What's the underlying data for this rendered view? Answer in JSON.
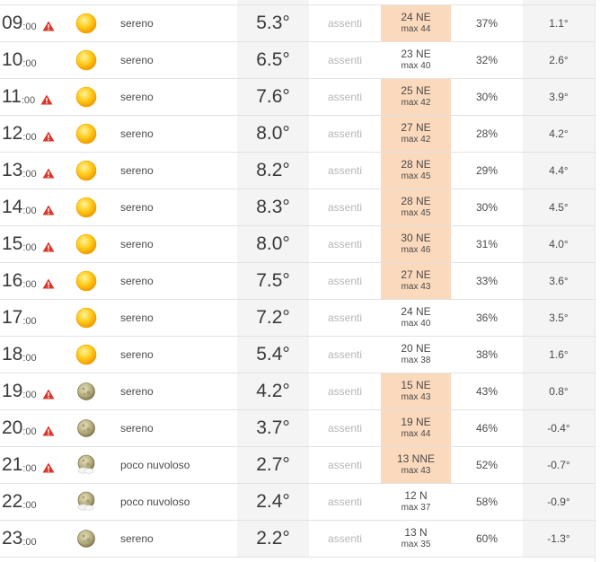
{
  "colors": {
    "warning": "#d9382b",
    "gust_highlight": "#fbd9bd",
    "sun": "#f7b500",
    "moon": "#a39b6a"
  },
  "rows": [
    {
      "hour": "09",
      "min": ":00",
      "warning": true,
      "icon": "sun-icon",
      "desc": "sereno",
      "temp": "5.3°",
      "precip": "assenti",
      "wind": "24 NE",
      "gust": "max 44",
      "highlight": true,
      "humidity": "37%",
      "dew": "1.1°"
    },
    {
      "hour": "10",
      "min": ":00",
      "warning": false,
      "icon": "sun-icon",
      "desc": "sereno",
      "temp": "6.5°",
      "precip": "assenti",
      "wind": "23 NE",
      "gust": "max 40",
      "highlight": false,
      "humidity": "32%",
      "dew": "2.6°"
    },
    {
      "hour": "11",
      "min": ":00",
      "warning": true,
      "icon": "sun-icon",
      "desc": "sereno",
      "temp": "7.6°",
      "precip": "assenti",
      "wind": "25 NE",
      "gust": "max 42",
      "highlight": true,
      "humidity": "30%",
      "dew": "3.9°"
    },
    {
      "hour": "12",
      "min": ":00",
      "warning": true,
      "icon": "sun-icon",
      "desc": "sereno",
      "temp": "8.0°",
      "precip": "assenti",
      "wind": "27 NE",
      "gust": "max 42",
      "highlight": true,
      "humidity": "28%",
      "dew": "4.2°"
    },
    {
      "hour": "13",
      "min": ":00",
      "warning": true,
      "icon": "sun-icon",
      "desc": "sereno",
      "temp": "8.2°",
      "precip": "assenti",
      "wind": "28 NE",
      "gust": "max 45",
      "highlight": true,
      "humidity": "29%",
      "dew": "4.4°"
    },
    {
      "hour": "14",
      "min": ":00",
      "warning": true,
      "icon": "sun-icon",
      "desc": "sereno",
      "temp": "8.3°",
      "precip": "assenti",
      "wind": "28 NE",
      "gust": "max 45",
      "highlight": true,
      "humidity": "30%",
      "dew": "4.5°"
    },
    {
      "hour": "15",
      "min": ":00",
      "warning": true,
      "icon": "sun-icon",
      "desc": "sereno",
      "temp": "8.0°",
      "precip": "assenti",
      "wind": "30 NE",
      "gust": "max 46",
      "highlight": true,
      "humidity": "31%",
      "dew": "4.0°"
    },
    {
      "hour": "16",
      "min": ":00",
      "warning": true,
      "icon": "sun-icon",
      "desc": "sereno",
      "temp": "7.5°",
      "precip": "assenti",
      "wind": "27 NE",
      "gust": "max 43",
      "highlight": true,
      "humidity": "33%",
      "dew": "3.6°"
    },
    {
      "hour": "17",
      "min": ":00",
      "warning": false,
      "icon": "sun-icon",
      "desc": "sereno",
      "temp": "7.2°",
      "precip": "assenti",
      "wind": "24 NE",
      "gust": "max 40",
      "highlight": false,
      "humidity": "36%",
      "dew": "3.5°"
    },
    {
      "hour": "18",
      "min": ":00",
      "warning": false,
      "icon": "sun-icon",
      "desc": "sereno",
      "temp": "5.4°",
      "precip": "assenti",
      "wind": "20 NE",
      "gust": "max 38",
      "highlight": false,
      "humidity": "38%",
      "dew": "1.6°"
    },
    {
      "hour": "19",
      "min": ":00",
      "warning": true,
      "icon": "moon-icon",
      "desc": "sereno",
      "temp": "4.2°",
      "precip": "assenti",
      "wind": "15 NE",
      "gust": "max 43",
      "highlight": true,
      "humidity": "43%",
      "dew": "0.8°"
    },
    {
      "hour": "20",
      "min": ":00",
      "warning": true,
      "icon": "moon-icon",
      "desc": "sereno",
      "temp": "3.7°",
      "precip": "assenti",
      "wind": "19 NE",
      "gust": "max 44",
      "highlight": true,
      "humidity": "46%",
      "dew": "-0.4°"
    },
    {
      "hour": "21",
      "min": ":00",
      "warning": true,
      "icon": "moon-cloud-icon",
      "desc": "poco nuvoloso",
      "temp": "2.7°",
      "precip": "assenti",
      "wind": "13 NNE",
      "gust": "max 43",
      "highlight": true,
      "humidity": "52%",
      "dew": "-0.7°"
    },
    {
      "hour": "22",
      "min": ":00",
      "warning": false,
      "icon": "moon-cloud-icon",
      "desc": "poco nuvoloso",
      "temp": "2.4°",
      "precip": "assenti",
      "wind": "12 N",
      "gust": "max 37",
      "highlight": false,
      "humidity": "58%",
      "dew": "-0.9°"
    },
    {
      "hour": "23",
      "min": ":00",
      "warning": false,
      "icon": "moon-icon",
      "desc": "sereno",
      "temp": "2.2°",
      "precip": "assenti",
      "wind": "13 N",
      "gust": "max 35",
      "highlight": false,
      "humidity": "60%",
      "dew": "-1.3°"
    }
  ]
}
